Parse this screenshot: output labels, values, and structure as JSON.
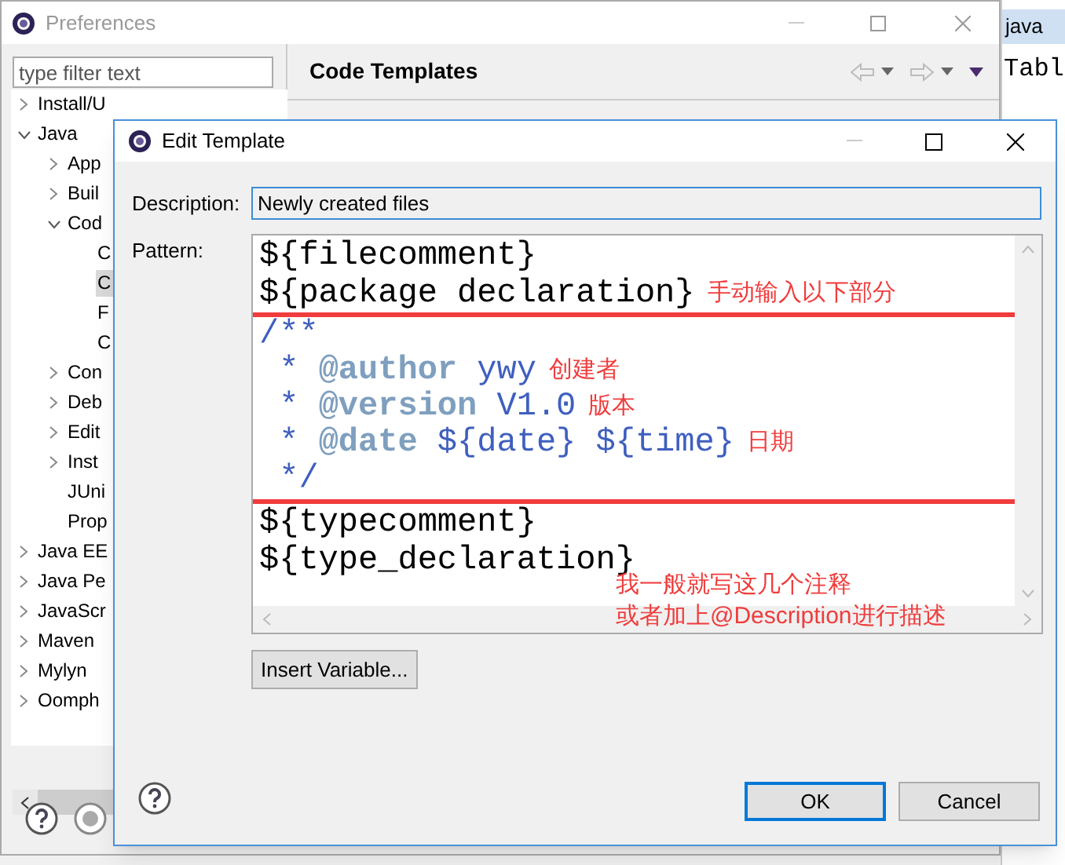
{
  "preferences": {
    "title": "Preferences",
    "filter": {
      "placeholder": "type filter text"
    },
    "tree": [
      {
        "label": "Install/U",
        "expanded": false
      },
      {
        "label": "Java",
        "expanded": true,
        "children": [
          {
            "label": "App",
            "expanded": false
          },
          {
            "label": "Buil",
            "expanded": false
          },
          {
            "label": "Cod",
            "expanded": true,
            "children": [
              {
                "label": "C",
                "selected": false
              },
              {
                "label": "C",
                "selected": true
              },
              {
                "label": "F",
                "selected": false
              },
              {
                "label": "C",
                "selected": false
              }
            ]
          },
          {
            "label": "Con",
            "expanded": false
          },
          {
            "label": "Deb",
            "expanded": false
          },
          {
            "label": "Edit",
            "expanded": false
          },
          {
            "label": "Inst",
            "expanded": false
          },
          {
            "label": "JUni"
          },
          {
            "label": "Prop"
          }
        ]
      },
      {
        "label": "Java EE",
        "expanded": false
      },
      {
        "label": "Java Pe",
        "expanded": false
      },
      {
        "label": "JavaScr",
        "expanded": false
      },
      {
        "label": "Maven",
        "expanded": false
      },
      {
        "label": "Mylyn",
        "expanded": false
      },
      {
        "label": "Oomph",
        "expanded": false
      }
    ],
    "page_title": "Code Templates"
  },
  "editor": {
    "tab": "java",
    "text": "Tabl"
  },
  "dialog": {
    "title": "Edit Template",
    "description_label": "Description:",
    "description": "Newly created files",
    "pattern_label": "Pattern:",
    "lines": [
      {
        "segments": [
          {
            "kind": "plain",
            "text": "${filecomment}"
          }
        ]
      },
      {
        "segments": [
          {
            "kind": "plain",
            "text": "${package declaration}"
          },
          {
            "kind": "note",
            "text": "手动输入以下部分"
          }
        ]
      },
      {
        "highlighted": true,
        "segments": [
          {
            "kind": "comment",
            "text": "/**"
          }
        ]
      },
      {
        "highlighted": true,
        "segments": [
          {
            "kind": "comment",
            "text": " * "
          },
          {
            "kind": "tag",
            "text": "@author"
          },
          {
            "kind": "comment",
            "text": " ywy"
          },
          {
            "kind": "note",
            "text": "创建者"
          }
        ]
      },
      {
        "highlighted": true,
        "segments": [
          {
            "kind": "comment",
            "text": " * "
          },
          {
            "kind": "tag",
            "text": "@version"
          },
          {
            "kind": "comment",
            "text": " V1.0"
          },
          {
            "kind": "note",
            "text": "版本"
          }
        ]
      },
      {
        "highlighted": true,
        "segments": [
          {
            "kind": "comment",
            "text": " * "
          },
          {
            "kind": "tag",
            "text": "@date"
          },
          {
            "kind": "comment",
            "text": " ${date} ${time}"
          },
          {
            "kind": "note",
            "text": "日期"
          }
        ]
      },
      {
        "highlighted": true,
        "segments": [
          {
            "kind": "comment",
            "text": " */"
          }
        ]
      },
      {
        "segments": [
          {
            "kind": "plain",
            "text": "${typecomment}"
          }
        ]
      },
      {
        "segments": [
          {
            "kind": "plain",
            "text": "${type_declaration}"
          }
        ]
      }
    ],
    "notes": [
      "我一般就写这几个注释",
      "或者加上@Description进行描述"
    ],
    "insert_variable": "Insert Variable...",
    "buttons": [
      {
        "label": "OK",
        "default": true
      },
      {
        "label": "Cancel",
        "default": false
      }
    ]
  }
}
